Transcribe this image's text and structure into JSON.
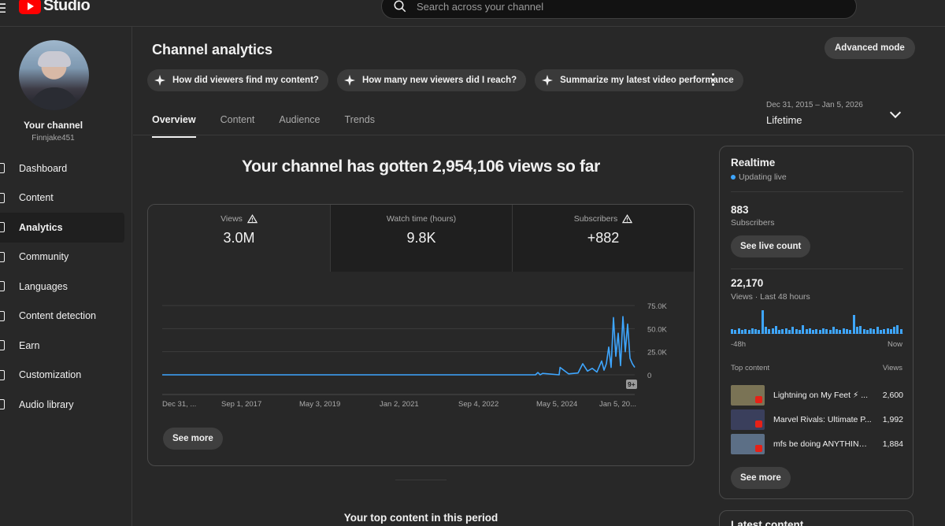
{
  "app": {
    "logo_text": "Studio"
  },
  "search": {
    "placeholder": "Search across your channel"
  },
  "channel": {
    "title": "Your channel",
    "handle": "Finnjake451"
  },
  "sidebar": {
    "items": [
      {
        "label": "Dashboard",
        "icon": "dashboard-icon"
      },
      {
        "label": "Content",
        "icon": "content-icon"
      },
      {
        "label": "Analytics",
        "icon": "analytics-icon",
        "active": true
      },
      {
        "label": "Community",
        "icon": "community-icon"
      },
      {
        "label": "Languages",
        "icon": "languages-icon"
      },
      {
        "label": "Content detection",
        "icon": "content-detection-icon"
      },
      {
        "label": "Earn",
        "icon": "earn-icon"
      },
      {
        "label": "Customization",
        "icon": "customization-icon"
      },
      {
        "label": "Audio library",
        "icon": "audio-library-icon"
      }
    ]
  },
  "header": {
    "title": "Channel analytics",
    "advanced_mode": "Advanced mode"
  },
  "chips": [
    "How did viewers find my content?",
    "How many new viewers did I reach?",
    "Summarize my latest video performance"
  ],
  "tabs": [
    "Overview",
    "Content",
    "Audience",
    "Trends"
  ],
  "range": {
    "dates": "Dec 31, 2015 – Jan 5, 2026",
    "label": "Lifetime"
  },
  "headline": "Your channel has gotten 2,954,106 views so far",
  "metrics": [
    {
      "label": "Views",
      "value": "3.0M",
      "warning": true
    },
    {
      "label": "Watch time (hours)",
      "value": "9.8K",
      "warning": false
    },
    {
      "label": "Subscribers",
      "value": "+882",
      "warning": true
    }
  ],
  "chart_data": {
    "type": "line",
    "x_ticks": [
      "Dec 31, ...",
      "Sep 1, 2017",
      "May 3, 2019",
      "Jan 2, 2021",
      "Sep 4, 2022",
      "May 5, 2024",
      "Jan 5, 20..."
    ],
    "y_ticks": [
      "75.0K",
      "50.0K",
      "25.0K",
      "0"
    ],
    "ylim": [
      0,
      75000
    ],
    "badge": "9+",
    "series": [
      {
        "color": "#3ea6ff",
        "x": [
          0,
          0.79,
          0.795,
          0.8,
          0.805,
          0.84,
          0.842,
          0.86,
          0.88,
          0.89,
          0.9,
          0.91,
          0.92,
          0.925,
          0.93,
          0.935,
          0.94,
          0.945,
          0.95,
          0.955,
          0.96,
          0.965,
          0.97,
          0.975,
          0.98,
          0.985,
          0.99,
          0.995,
          1.0
        ],
        "values": [
          0,
          0,
          2500,
          0,
          1500,
          0,
          8000,
          1000,
          2000,
          12000,
          4000,
          7000,
          3000,
          9000,
          15000,
          5000,
          12000,
          30000,
          8000,
          62000,
          20000,
          45000,
          10000,
          63000,
          25000,
          55000,
          18000,
          12000,
          8000
        ]
      }
    ]
  },
  "card": {
    "see_more": "See more"
  },
  "top_content_title": "Your top content in this period",
  "realtime": {
    "title": "Realtime",
    "updating": "Updating live",
    "subscribers_count": "883",
    "subscribers_label": "Subscribers",
    "see_live_count": "See live count",
    "views_count": "22,170",
    "views_label": "Views · Last 48 hours",
    "bars": [
      6,
      5,
      7,
      5,
      6,
      5,
      7,
      6,
      5,
      28,
      8,
      6,
      7,
      9,
      5,
      6,
      7,
      5,
      8,
      6,
      5,
      10,
      6,
      7,
      5,
      6,
      5,
      7,
      6,
      5,
      8,
      6,
      5,
      7,
      6,
      5,
      22,
      8,
      9,
      6,
      5,
      7,
      6,
      8,
      5,
      6,
      7,
      6,
      8,
      10,
      6
    ],
    "axis_start": "-48h",
    "axis_end": "Now",
    "top_content_label": "Top content",
    "views_col_label": "Views",
    "rows": [
      {
        "title": "Lightning on My Feet ⚡ ...",
        "views": "2,600",
        "thumb": "#7a7355"
      },
      {
        "title": "Marvel Rivals: Ultimate P...",
        "views": "1,992",
        "thumb": "#3a3f5c"
      },
      {
        "title": "mfs be doing ANYTHING ...",
        "views": "1,884",
        "thumb": "#5c6f86"
      }
    ],
    "see_more": "See more"
  },
  "latest": {
    "title": "Latest content"
  }
}
